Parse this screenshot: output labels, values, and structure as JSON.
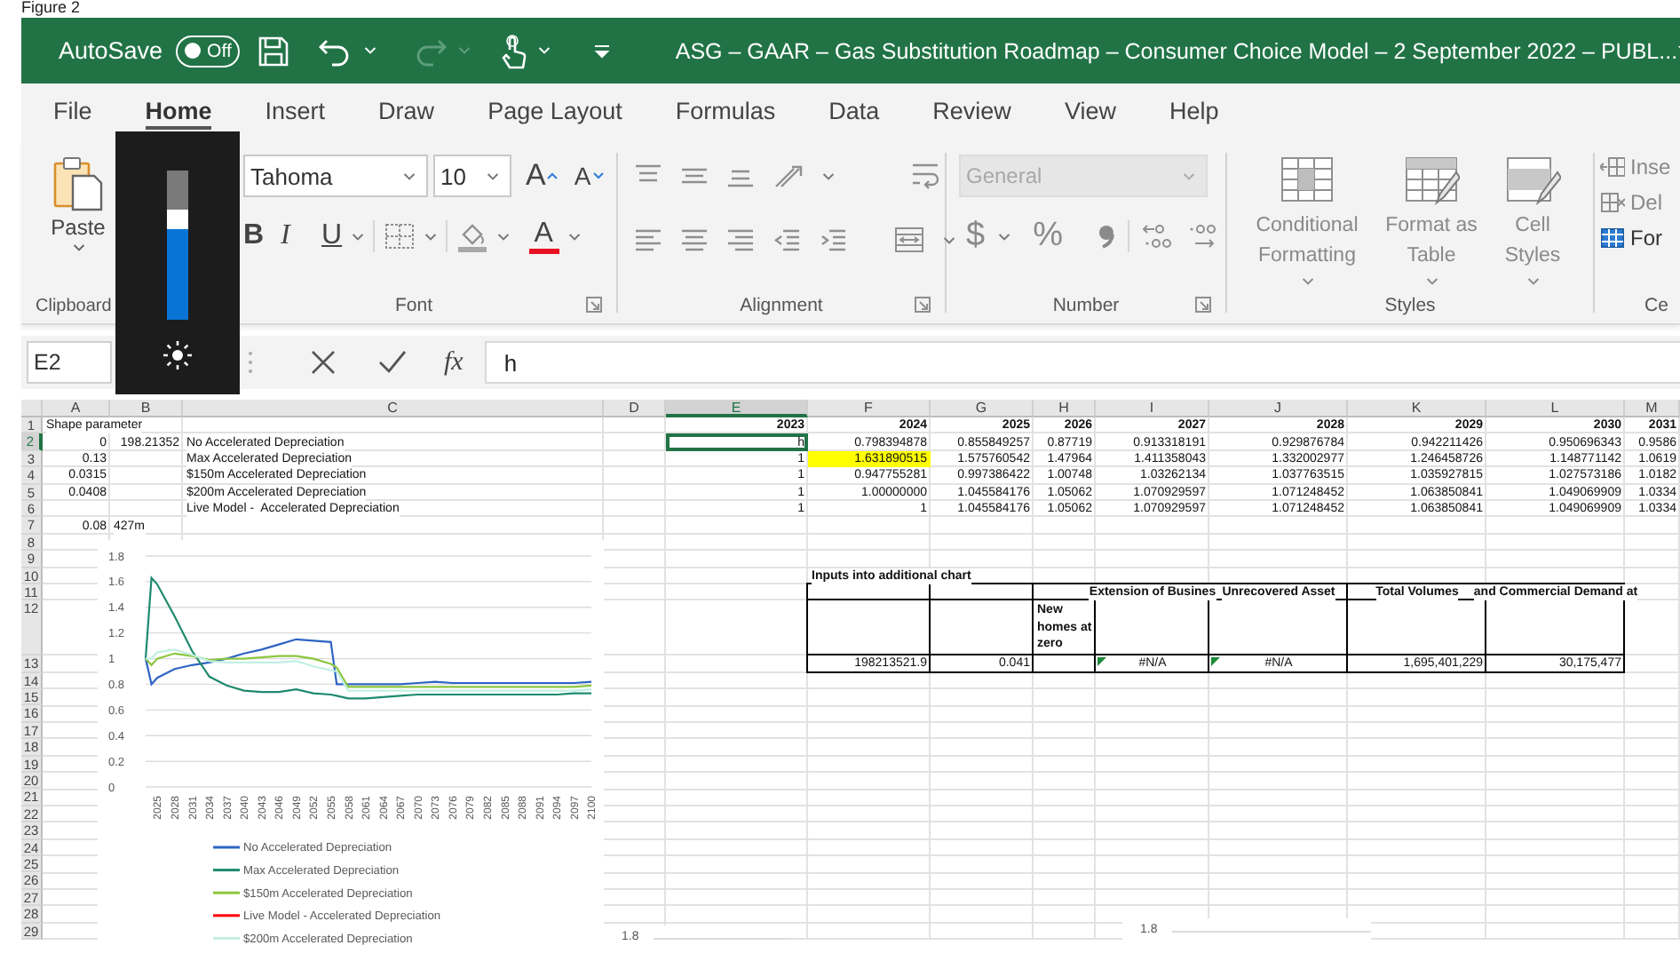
{
  "figure_caption": "Figure 2",
  "title_bar": {
    "autosave_label": "AutoSave",
    "autosave": {
      "label": "Off",
      "on": false
    },
    "redo": {
      "disabled": true
    },
    "title": "ASG – GAAR – Gas Substitution Roadmap – Consumer Choice Model – 2 September 2022 – PUBL..."
  },
  "tabs": [
    {
      "label": "File",
      "selected": false
    },
    {
      "label": "Home",
      "selected": true
    },
    {
      "label": "Insert",
      "selected": false
    },
    {
      "label": "Draw",
      "selected": false
    },
    {
      "label": "Page Layout",
      "selected": false
    },
    {
      "label": "Formulas",
      "selected": false
    },
    {
      "label": "Data",
      "selected": false
    },
    {
      "label": "Review",
      "selected": false
    },
    {
      "label": "View",
      "selected": false
    },
    {
      "label": "Help",
      "selected": false
    }
  ],
  "ribbon": {
    "clipboard": {
      "paste": "Paste",
      "label": "Clipboard"
    },
    "font": {
      "name": "Tahoma",
      "size": "10",
      "grow": "A",
      "shrink": "A",
      "bold": "B",
      "italic": "I",
      "underline": "U",
      "font_color": "A",
      "label": "Font"
    },
    "alignment": {
      "label": "Alignment"
    },
    "number": {
      "format": "General",
      "format_disabled": true,
      "currency": "$",
      "percent": "%",
      "label": "Number"
    },
    "styles": {
      "buttons": [
        "Conditional Formatting",
        "Format as Table",
        "Cell Styles"
      ],
      "label": "Styles"
    },
    "cells": {
      "buttons": [
        "Inse",
        "Del",
        "For"
      ],
      "label": "Ce"
    }
  },
  "brightness_overlay": {
    "level": 0.67
  },
  "formula_bar": {
    "name_box": "E2",
    "function_label": "fx",
    "formula": "h"
  },
  "sheet": {
    "columns": [
      "A",
      "B",
      "C",
      "D",
      "E",
      "F",
      "G",
      "H",
      "I",
      "J",
      "K",
      "L",
      "M"
    ],
    "rows": [
      {
        "number": "1",
        "kind": "plain",
        "cells": {
          "A": {
            "text": "Shape parameter",
            "kind": "text",
            "selected": false,
            "highlighted": false
          },
          "E": {
            "text": "2023",
            "kind": "header",
            "selected": false,
            "highlighted": false
          },
          "F": {
            "text": "2024",
            "kind": "header",
            "selected": false,
            "highlighted": false
          },
          "G": {
            "text": "2025",
            "kind": "header",
            "selected": false,
            "highlighted": false
          },
          "H": {
            "text": "2026",
            "kind": "header",
            "selected": false,
            "highlighted": false
          },
          "I": {
            "text": "2027",
            "kind": "header",
            "selected": false,
            "highlighted": false
          },
          "J": {
            "text": "2028",
            "kind": "header",
            "selected": false,
            "highlighted": false
          },
          "K": {
            "text": "2029",
            "kind": "header",
            "selected": false,
            "highlighted": false
          },
          "L": {
            "text": "2030",
            "kind": "header",
            "selected": false,
            "highlighted": false
          },
          "M": {
            "text": "2031",
            "kind": "header",
            "selected": false,
            "highlighted": false
          }
        }
      },
      {
        "number": "2",
        "kind": "plain",
        "cells": {
          "A": {
            "text": "0",
            "kind": "number",
            "selected": false,
            "highlighted": false
          },
          "B": {
            "text": "198.21352",
            "kind": "number",
            "selected": false,
            "highlighted": false
          },
          "C": {
            "text": "No Accelerated Depreciation",
            "kind": "text",
            "selected": false,
            "highlighted": false
          },
          "E": {
            "text": "h",
            "kind": "number",
            "selected": true,
            "highlighted": false
          },
          "F": {
            "text": "0.798394878",
            "kind": "number",
            "selected": false,
            "highlighted": false
          },
          "G": {
            "text": "0.855849257",
            "kind": "number",
            "selected": false,
            "highlighted": false
          },
          "H": {
            "text": "0.87719",
            "kind": "number",
            "selected": false,
            "highlighted": false
          },
          "I": {
            "text": "0.913318191",
            "kind": "number",
            "selected": false,
            "highlighted": false
          },
          "J": {
            "text": "0.929876784",
            "kind": "number",
            "selected": false,
            "highlighted": false
          },
          "K": {
            "text": "0.942211426",
            "kind": "number",
            "selected": false,
            "highlighted": false
          },
          "L": {
            "text": "0.950696343",
            "kind": "number",
            "selected": false,
            "highlighted": false
          },
          "M": {
            "text": "0.9586",
            "kind": "number",
            "selected": false,
            "highlighted": false
          }
        }
      },
      {
        "number": "3",
        "kind": "plain",
        "cells": {
          "A": {
            "text": "0.13",
            "kind": "number",
            "selected": false,
            "highlighted": false
          },
          "C": {
            "text": "Max Accelerated Depreciation",
            "kind": "text",
            "selected": false,
            "highlighted": false
          },
          "E": {
            "text": "1",
            "kind": "number",
            "selected": false,
            "highlighted": false
          },
          "F": {
            "text": "1.631890515",
            "kind": "number",
            "selected": false,
            "highlighted": true
          },
          "G": {
            "text": "1.575760542",
            "kind": "number",
            "selected": false,
            "highlighted": false
          },
          "H": {
            "text": "1.47964",
            "kind": "number",
            "selected": false,
            "highlighted": false
          },
          "I": {
            "text": "1.411358043",
            "kind": "number",
            "selected": false,
            "highlighted": false
          },
          "J": {
            "text": "1.332002977",
            "kind": "number",
            "selected": false,
            "highlighted": false
          },
          "K": {
            "text": "1.246458726",
            "kind": "number",
            "selected": false,
            "highlighted": false
          },
          "L": {
            "text": "1.148771142",
            "kind": "number",
            "selected": false,
            "highlighted": false
          },
          "M": {
            "text": "1.0619",
            "kind": "number",
            "selected": false,
            "highlighted": false
          }
        }
      },
      {
        "number": "4",
        "kind": "plain",
        "cells": {
          "A": {
            "text": "0.0315",
            "kind": "number",
            "selected": false,
            "highlighted": false
          },
          "C": {
            "text": "$150m Accelerated Depreciation",
            "kind": "text",
            "selected": false,
            "highlighted": false
          },
          "E": {
            "text": "1",
            "kind": "number",
            "selected": false,
            "highlighted": false
          },
          "F": {
            "text": "0.947755281",
            "kind": "number",
            "selected": false,
            "highlighted": false
          },
          "G": {
            "text": "0.997386422",
            "kind": "number",
            "selected": false,
            "highlighted": false
          },
          "H": {
            "text": "1.00748",
            "kind": "number",
            "selected": false,
            "highlighted": false
          },
          "I": {
            "text": "1.03262134",
            "kind": "number",
            "selected": false,
            "highlighted": false
          },
          "J": {
            "text": "1.037763515",
            "kind": "number",
            "selected": false,
            "highlighted": false
          },
          "K": {
            "text": "1.035927815",
            "kind": "number",
            "selected": false,
            "highlighted": false
          },
          "L": {
            "text": "1.027573186",
            "kind": "number",
            "selected": false,
            "highlighted": false
          },
          "M": {
            "text": "1.0182",
            "kind": "number",
            "selected": false,
            "highlighted": false
          }
        }
      },
      {
        "number": "5",
        "kind": "plain",
        "cells": {
          "A": {
            "text": "0.0408",
            "kind": "number",
            "selected": false,
            "highlighted": false
          },
          "C": {
            "text": "$200m Accelerated Depreciation",
            "kind": "text",
            "selected": false,
            "highlighted": false
          },
          "E": {
            "text": "1",
            "kind": "number",
            "selected": false,
            "highlighted": false
          },
          "F": {
            "text": "1.00000000",
            "kind": "number",
            "selected": false,
            "highlighted": false
          },
          "G": {
            "text": "1.045584176",
            "kind": "number",
            "selected": false,
            "highlighted": false
          },
          "H": {
            "text": "1.05062",
            "kind": "number",
            "selected": false,
            "highlighted": false
          },
          "I": {
            "text": "1.070929597",
            "kind": "number",
            "selected": false,
            "highlighted": false
          },
          "J": {
            "text": "1.071248452",
            "kind": "number",
            "selected": false,
            "highlighted": false
          },
          "K": {
            "text": "1.063850841",
            "kind": "number",
            "selected": false,
            "highlighted": false
          },
          "L": {
            "text": "1.049069909",
            "kind": "number",
            "selected": false,
            "highlighted": false
          },
          "M": {
            "text": "1.0334",
            "kind": "number",
            "selected": false,
            "highlighted": false
          }
        }
      },
      {
        "number": "6",
        "kind": "plain",
        "cells": {
          "C": {
            "text": "Live Model -  Accelerated Depreciation",
            "kind": "text",
            "selected": false,
            "highlighted": false
          },
          "E": {
            "text": "1",
            "kind": "number",
            "selected": false,
            "highlighted": false
          },
          "F": {
            "text": "1",
            "kind": "number",
            "selected": false,
            "highlighted": false
          },
          "G": {
            "text": "1.045584176",
            "kind": "number",
            "selected": false,
            "highlighted": false
          },
          "H": {
            "text": "1.05062",
            "kind": "number",
            "selected": false,
            "highlighted": false
          },
          "I": {
            "text": "1.070929597",
            "kind": "number",
            "selected": false,
            "highlighted": false
          },
          "J": {
            "text": "1.071248452",
            "kind": "number",
            "selected": false,
            "highlighted": false
          },
          "K": {
            "text": "1.063850841",
            "kind": "number",
            "selected": false,
            "highlighted": false
          },
          "L": {
            "text": "1.049069909",
            "kind": "number",
            "selected": false,
            "highlighted": false
          },
          "M": {
            "text": "1.0334",
            "kind": "number",
            "selected": false,
            "highlighted": false
          }
        }
      },
      {
        "number": "7",
        "kind": "plain",
        "cells": {
          "A": {
            "text": "0.08",
            "kind": "number",
            "selected": false,
            "highlighted": false
          },
          "B": {
            "text": "427m",
            "kind": "text",
            "selected": false,
            "highlighted": false
          }
        }
      },
      {
        "number": "8",
        "kind": "plain"
      },
      {
        "number": "9",
        "kind": "plain"
      },
      {
        "number": "10",
        "kind": "plain",
        "cells": {
          "F": {
            "text": "Inputs into additional chart",
            "kind": "title",
            "selected": false,
            "highlighted": false
          }
        }
      },
      {
        "number": "11",
        "kind": "table",
        "cells": {
          "I": {
            "text": "Extension of Busines",
            "kind": "column_title",
            "selected": false,
            "highlighted": false
          },
          "J": {
            "text": "Unrecovered Asset",
            "kind": "column_title",
            "selected": false,
            "highlighted": false
          },
          "K": {
            "text": "Total Volumes",
            "kind": "column_title",
            "selected": false,
            "highlighted": false
          },
          "L": {
            "text": "and Commercial Demand at",
            "kind": "column_title",
            "selected": false,
            "highlighted": false
          }
        }
      },
      {
        "number": "12",
        "kind": "table",
        "cells": {
          "H": {
            "text": "New homes at zero",
            "kind": "wrap",
            "selected": false,
            "highlighted": false
          }
        }
      },
      {
        "number": "13",
        "kind": "table",
        "cells": {
          "F": {
            "text": "198213521.9",
            "kind": "number",
            "selected": false,
            "highlighted": false
          },
          "G": {
            "text": "0.041",
            "kind": "number",
            "selected": false,
            "highlighted": false
          },
          "I": {
            "text": "#N/A",
            "kind": "error",
            "selected": false,
            "highlighted": false
          },
          "J": {
            "text": "#N/A",
            "kind": "error",
            "selected": false,
            "highlighted": false
          },
          "K": {
            "text": "1,695,401,229",
            "kind": "number",
            "selected": false,
            "highlighted": false
          },
          "L": {
            "text": "30,175,477",
            "kind": "number",
            "selected": false,
            "highlighted": false
          }
        }
      },
      {
        "number": "14",
        "kind": "plain"
      },
      {
        "number": "15",
        "kind": "plain"
      },
      {
        "number": "16",
        "kind": "plain"
      },
      {
        "number": "17",
        "kind": "plain"
      },
      {
        "number": "18",
        "kind": "plain"
      },
      {
        "number": "19",
        "kind": "plain"
      },
      {
        "number": "20",
        "kind": "plain"
      },
      {
        "number": "21",
        "kind": "plain"
      },
      {
        "number": "22",
        "kind": "plain"
      },
      {
        "number": "23",
        "kind": "plain"
      },
      {
        "number": "24",
        "kind": "plain"
      },
      {
        "number": "25",
        "kind": "plain"
      },
      {
        "number": "26",
        "kind": "plain"
      },
      {
        "number": "27",
        "kind": "plain"
      },
      {
        "number": "28",
        "kind": "plain"
      },
      {
        "number": "29",
        "kind": "plain"
      }
    ],
    "chart": {
      "chart_data": {
        "type": "line",
        "grid": true,
        "legend": true,
        "x": [
          2023,
          2024,
          2025,
          2028,
          2031,
          2034,
          2037,
          2040,
          2043,
          2046,
          2049,
          2052,
          2055,
          2056,
          2058,
          2061,
          2064,
          2067,
          2070,
          2073,
          2076,
          2079,
          2082,
          2085,
          2088,
          2091,
          2094,
          2097,
          2100
        ],
        "xlim": [
          2023,
          2100
        ],
        "ylim": [
          0,
          1.8
        ],
        "xticks": [
          {
            "value": 2025,
            "label": "2025"
          },
          {
            "value": 2028,
            "label": "2028"
          },
          {
            "value": 2031,
            "label": "2031"
          },
          {
            "value": 2034,
            "label": "2034"
          },
          {
            "value": 2037,
            "label": "2037"
          },
          {
            "value": 2040,
            "label": "2040"
          },
          {
            "value": 2043,
            "label": "2043"
          },
          {
            "value": 2046,
            "label": "2046"
          },
          {
            "value": 2049,
            "label": "2049"
          },
          {
            "value": 2052,
            "label": "2052"
          },
          {
            "value": 2055,
            "label": "2055"
          },
          {
            "value": 2058,
            "label": "2058"
          },
          {
            "value": 2061,
            "label": "2061"
          },
          {
            "value": 2064,
            "label": "2064"
          },
          {
            "value": 2067,
            "label": "2067"
          },
          {
            "value": 2070,
            "label": "2070"
          },
          {
            "value": 2073,
            "label": "2073"
          },
          {
            "value": 2076,
            "label": "2076"
          },
          {
            "value": 2079,
            "label": "2079"
          },
          {
            "value": 2082,
            "label": "2082"
          },
          {
            "value": 2085,
            "label": "2085"
          },
          {
            "value": 2088,
            "label": "2088"
          },
          {
            "value": 2091,
            "label": "2091"
          },
          {
            "value": 2094,
            "label": "2094"
          },
          {
            "value": 2097,
            "label": "2097"
          },
          {
            "value": 2100,
            "label": "2100"
          }
        ],
        "yticks": [
          {
            "value": 0,
            "label": "0"
          },
          {
            "value": 0.2,
            "label": "0.2"
          },
          {
            "value": 0.4,
            "label": "0.4"
          },
          {
            "value": 0.6,
            "label": "0.6"
          },
          {
            "value": 0.8,
            "label": "0.8"
          },
          {
            "value": 1,
            "label": "1"
          },
          {
            "value": 1.2,
            "label": "1.2"
          },
          {
            "value": 1.4,
            "label": "1.4"
          },
          {
            "value": 1.6,
            "label": "1.6"
          },
          {
            "value": 1.8,
            "label": "1.8"
          }
        ],
        "series": [
          {
            "name": "No Accelerated Depreciation",
            "color": "#2e64c4",
            "values": [
              1,
              0.8,
              0.85,
              0.92,
              0.95,
              0.97,
              1.0,
              1.04,
              1.07,
              1.11,
              1.15,
              1.14,
              1.13,
              0.8,
              0.8,
              0.8,
              0.8,
              0.8,
              0.81,
              0.82,
              0.81,
              0.81,
              0.81,
              0.81,
              0.81,
              0.81,
              0.81,
              0.81,
              0.82
            ]
          },
          {
            "name": "Max Accelerated Depreciation",
            "color": "#1e8a6e",
            "values": [
              1,
              1.63,
              1.58,
              1.33,
              1.06,
              0.86,
              0.79,
              0.75,
              0.74,
              0.74,
              0.76,
              0.73,
              0.72,
              0.71,
              0.69,
              0.69,
              0.7,
              0.71,
              0.72,
              0.72,
              0.72,
              0.72,
              0.72,
              0.72,
              0.72,
              0.72,
              0.72,
              0.73,
              0.73
            ]
          },
          {
            "name": "$150m Accelerated Depreciation",
            "color": "#8cc63f",
            "values": [
              1,
              0.95,
              1.0,
              1.04,
              1.02,
              0.99,
              1.0,
              1.0,
              1.01,
              1.02,
              1.02,
              1.0,
              0.96,
              0.93,
              0.78,
              0.78,
              0.78,
              0.78,
              0.78,
              0.78,
              0.78,
              0.78,
              0.78,
              0.78,
              0.78,
              0.78,
              0.78,
              0.78,
              0.79
            ]
          },
          {
            "name": "Live Model -  Accelerated Depreciation",
            "color": "#ff0000",
            "values": [
              null,
              null,
              null,
              null,
              null,
              null,
              null,
              null,
              null,
              null,
              null,
              null,
              null,
              null,
              null,
              null,
              null,
              null,
              null,
              null,
              null,
              null,
              null,
              null,
              null,
              null,
              null,
              null,
              null
            ]
          },
          {
            "name": "$200m Accelerated Depreciation",
            "color": "#c2efe4",
            "values": [
              1,
              1.0,
              1.05,
              1.07,
              1.03,
              0.98,
              0.97,
              0.97,
              0.97,
              0.97,
              0.98,
              0.94,
              0.91,
              0.9,
              0.75,
              0.75,
              0.75,
              0.75,
              0.75,
              0.75,
              0.75,
              0.75,
              0.75,
              0.75,
              0.75,
              0.75,
              0.75,
              0.75,
              0.76
            ]
          }
        ]
      }
    },
    "partial_charts": [
      {
        "tick": "1.8"
      },
      {
        "tick": "1.8"
      }
    ]
  }
}
